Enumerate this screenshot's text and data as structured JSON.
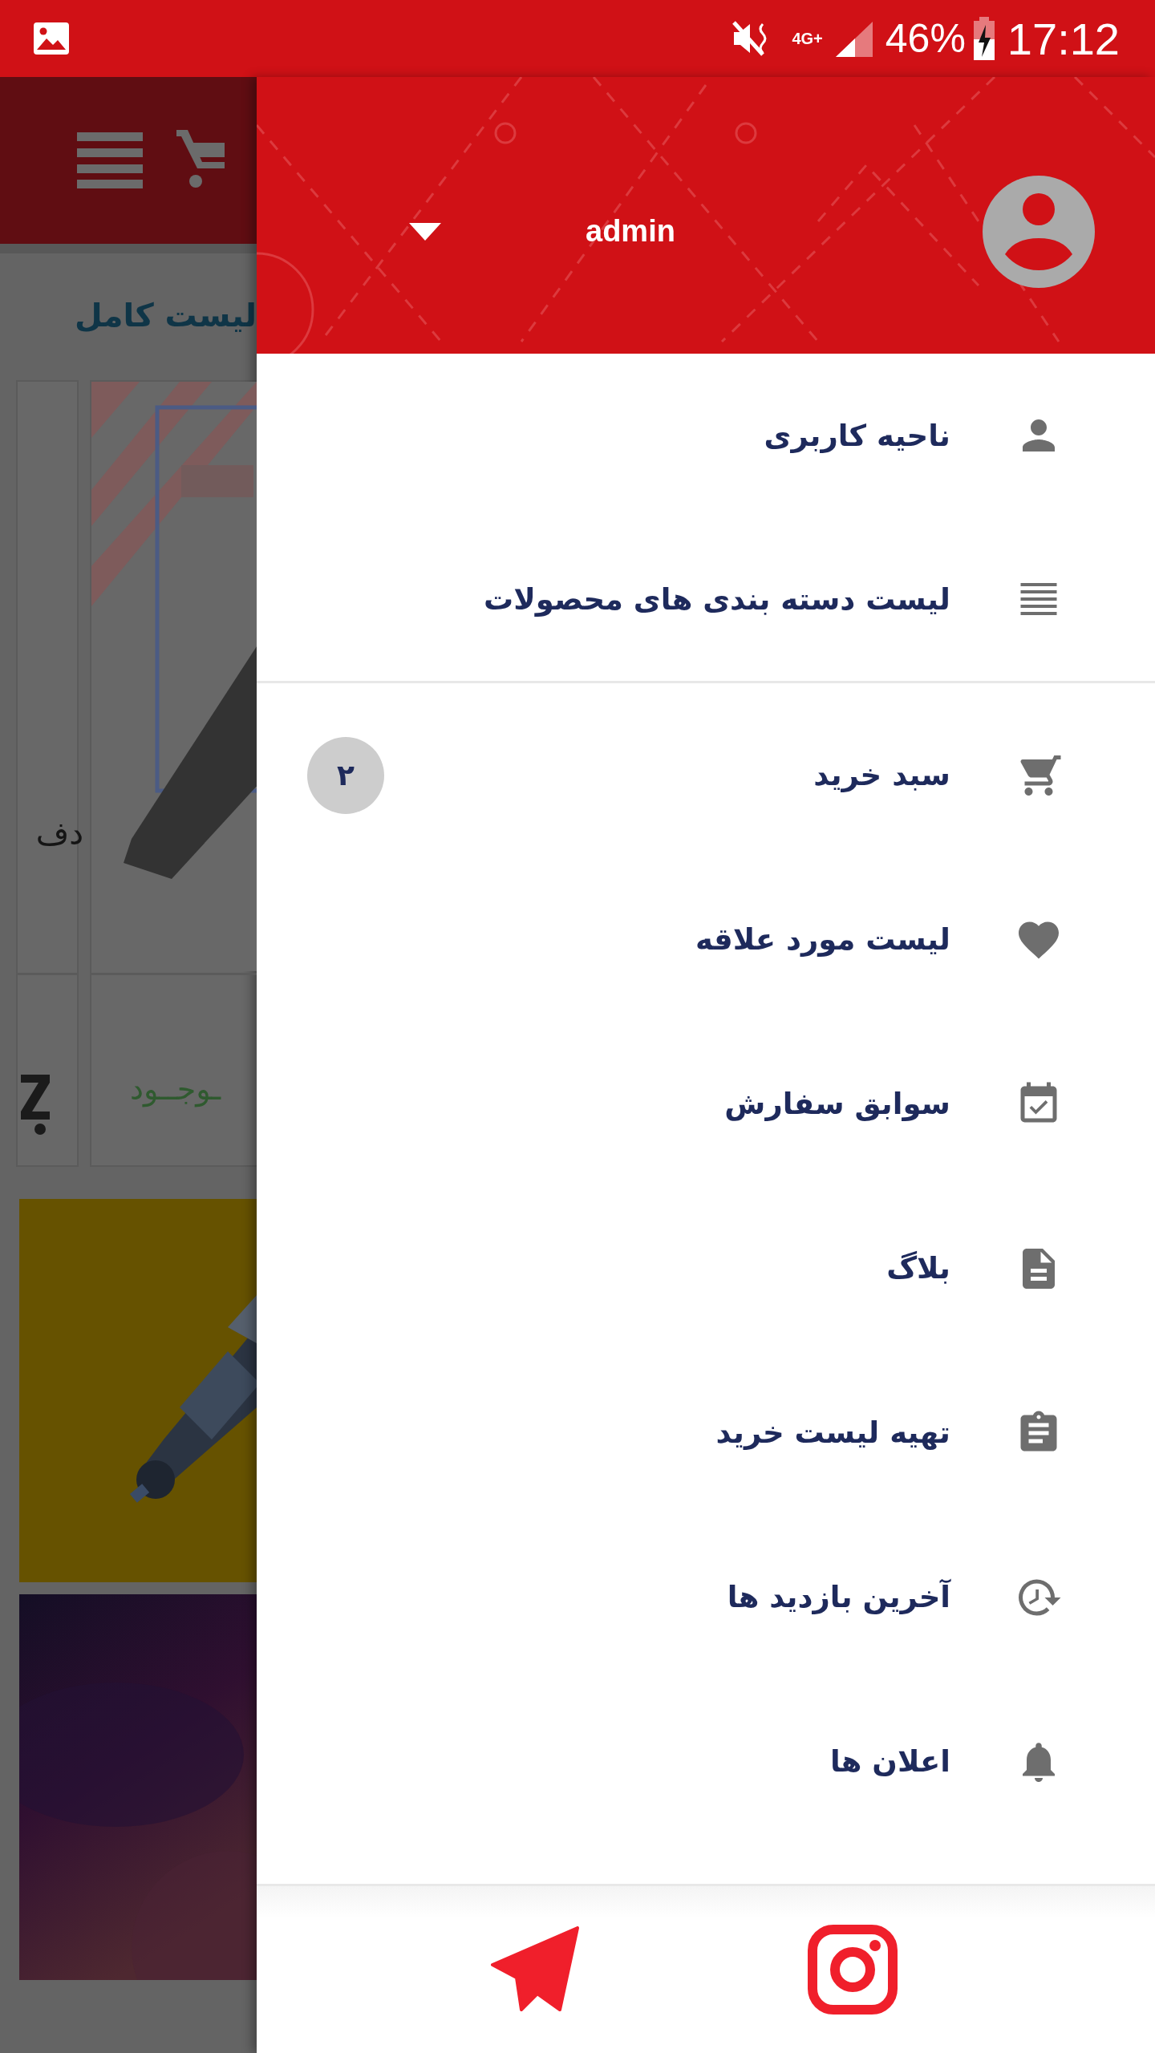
{
  "status_bar": {
    "network": "4G+",
    "battery": "46%",
    "time": "17:12"
  },
  "background_app": {
    "link": "لیست کامل",
    "product_title": "دف",
    "stock": "ـوجــود"
  },
  "drawer": {
    "username": "admin",
    "menu_groups": [
      [
        {
          "label": "ناحیه کاربری"
        },
        {
          "label": "لیست دسته بندی های محصولات"
        }
      ],
      [
        {
          "label": "سبد خرید",
          "badge": "۲"
        },
        {
          "label": "لیست مورد علاقه"
        },
        {
          "label": "سوابق سفارش"
        },
        {
          "label": "بلاگ"
        },
        {
          "label": "تهیه لیست خرید"
        },
        {
          "label": "آخرین بازدید ها"
        },
        {
          "label": "اعلان ها"
        }
      ]
    ]
  }
}
